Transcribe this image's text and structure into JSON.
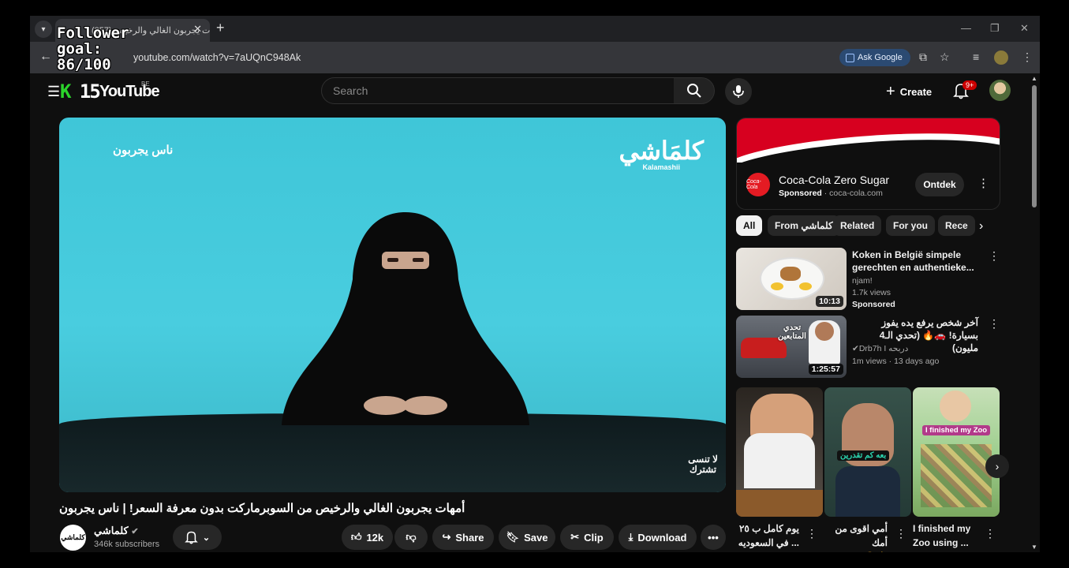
{
  "overlay": {
    "line1": "Follower",
    "line2": "goal:",
    "line3": "86/100"
  },
  "browser": {
    "tab_title": "(857) أمهات يجربون الغالي والرخيص",
    "url": "youtube.com/watch?v=7aUQnC948Ak",
    "ask_google": "Ask Google"
  },
  "header": {
    "k15": "K",
    "k15_num": "15",
    "logo": "YouTube",
    "country": "BE",
    "search_placeholder": "Search",
    "create": "Create",
    "notif_count": "9+"
  },
  "video": {
    "overlay_top_left": "ناس يجربون",
    "brand_ar": "كلمَاشي",
    "brand_en": "Kalamashii",
    "corner_logo_1": "لا تنسى",
    "corner_logo_2": "تشترك",
    "title": "أمهات يجربون الغالي والرخيص من السوبرماركت بدون معرفة السعر! | ناس يجربون",
    "channel": "كلماشي",
    "channel_avatar": "كلماشي",
    "subscribers": "346k subscribers",
    "likes": "12k",
    "share": "Share",
    "save": "Save",
    "clip": "Clip",
    "download": "Download"
  },
  "ad": {
    "name": "Coca-Cola Zero Sugar",
    "sponsored": "Sponsored",
    "domain": "· coca-cola.com",
    "cta": "Ontdek",
    "logo_text": "Coca-Cola"
  },
  "chips": [
    "All",
    "From كلماشي",
    "Related",
    "For you",
    "Rece"
  ],
  "recs": [
    {
      "title": "Koken in België simpele gerechten en authentieke...",
      "channel": "njam!",
      "views": "1.7k views",
      "extra": "Sponsored",
      "duration": "10:13"
    },
    {
      "title": "آخر شخص يرفع يده يفوز بسيارة! 🚗🔥 (تحدي الـ4 مليون)",
      "channel": "Drb7h I دربحه",
      "views": "1m views · 13 days ago",
      "duration": "1:25:57",
      "thumb_text": "تحدي المتابعين"
    }
  ],
  "shorts": [
    {
      "title_1": "يوم كامل ب ٢٥",
      "title_2": "... في السعوديه",
      "overlay": ""
    },
    {
      "title_1": "أمي اقوى من أمك",
      "title_2": "💪😂",
      "overlay": "بعه كم تقدرين"
    },
    {
      "title_1": "I finished my",
      "title_2": "Zoo using ...",
      "overlay": "I finished my Zoo"
    }
  ]
}
